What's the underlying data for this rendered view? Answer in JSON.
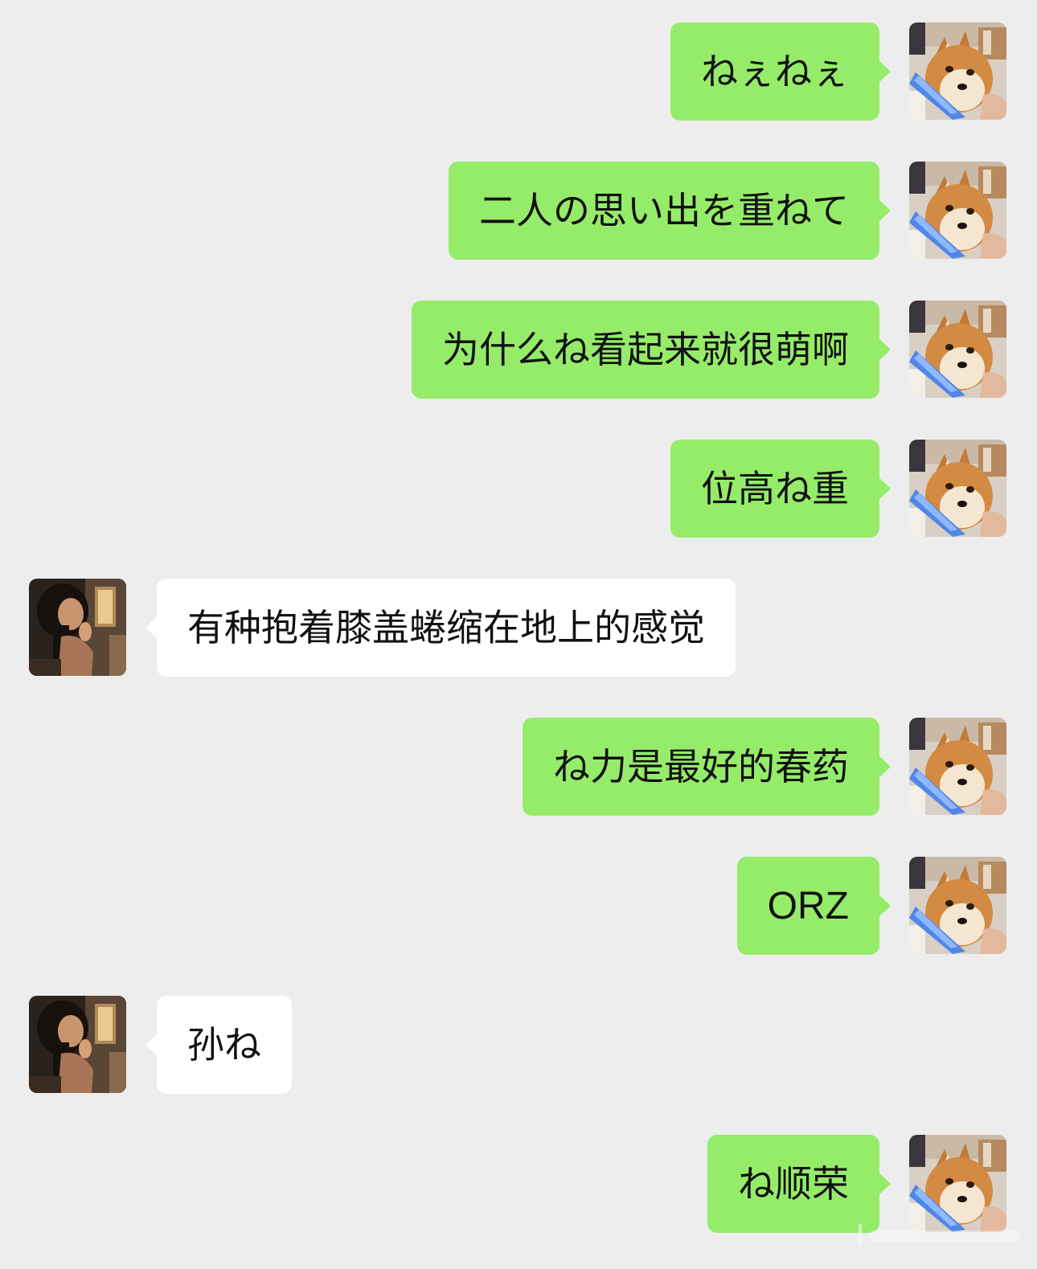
{
  "conversation": {
    "messages": [
      {
        "sender": "me",
        "text": "ねぇねぇ",
        "avatar": "shiba-dog-avatar"
      },
      {
        "sender": "me",
        "text": "二人の思い出を重ねて",
        "avatar": "shiba-dog-avatar"
      },
      {
        "sender": "me",
        "text": "为什么ね看起来就很萌啊",
        "avatar": "shiba-dog-avatar"
      },
      {
        "sender": "me",
        "text": "位高ね重",
        "avatar": "shiba-dog-avatar"
      },
      {
        "sender": "other",
        "text": "有种抱着膝盖蜷缩在地上的感觉",
        "avatar": "girl-photo-avatar"
      },
      {
        "sender": "me",
        "text": "ね力是最好的春药",
        "avatar": "shiba-dog-avatar"
      },
      {
        "sender": "me",
        "text": "ORZ",
        "avatar": "shiba-dog-avatar"
      },
      {
        "sender": "other",
        "text": "孙ね",
        "avatar": "girl-photo-avatar"
      },
      {
        "sender": "me",
        "text": "ね顺荣",
        "avatar": "shiba-dog-avatar"
      }
    ]
  },
  "colors": {
    "background": "#ededed",
    "sent_bubble": "#95ec69",
    "received_bubble": "#ffffff",
    "text": "#111111"
  }
}
